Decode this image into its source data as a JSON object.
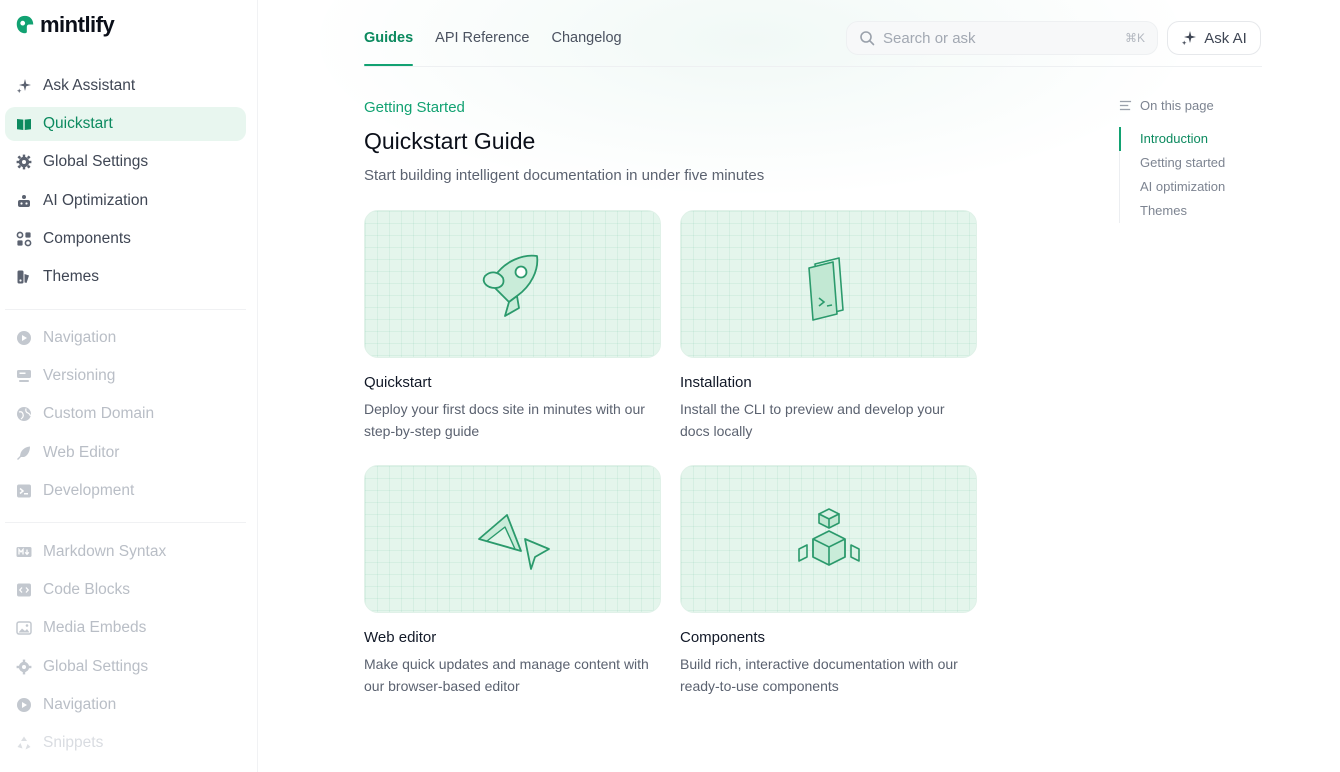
{
  "brand": {
    "name": "mintlify",
    "color": "#12a272"
  },
  "sidebar": {
    "primary": [
      {
        "label": "Ask Assistant",
        "icon": "sparkles-icon",
        "state": "normal"
      },
      {
        "label": "Quickstart",
        "icon": "book-icon",
        "state": "active"
      },
      {
        "label": "Global Settings",
        "icon": "gear-icon",
        "state": "normal"
      },
      {
        "label": "AI Optimization",
        "icon": "robot-icon",
        "state": "normal"
      },
      {
        "label": "Components",
        "icon": "components-icon",
        "state": "normal"
      },
      {
        "label": "Themes",
        "icon": "palette-icon",
        "state": "normal"
      }
    ],
    "secondary": [
      {
        "label": "Navigation",
        "icon": "compass-icon"
      },
      {
        "label": "Versioning",
        "icon": "versions-icon"
      },
      {
        "label": "Custom Domain",
        "icon": "globe-icon"
      },
      {
        "label": "Web Editor",
        "icon": "feather-icon"
      },
      {
        "label": "Development",
        "icon": "terminal-icon"
      }
    ],
    "tertiary": [
      {
        "label": "Markdown Syntax",
        "icon": "markdown-icon"
      },
      {
        "label": "Code Blocks",
        "icon": "code-icon"
      },
      {
        "label": "Media Embeds",
        "icon": "image-icon"
      },
      {
        "label": "Global Settings",
        "icon": "gear-icon"
      },
      {
        "label": "Navigation",
        "icon": "compass-icon"
      },
      {
        "label": "Snippets",
        "icon": "recycle-icon"
      }
    ]
  },
  "header": {
    "tabs": [
      {
        "label": "Guides",
        "active": true
      },
      {
        "label": "API Reference",
        "active": false
      },
      {
        "label": "Changelog",
        "active": false
      }
    ],
    "search": {
      "placeholder": "Search or ask",
      "shortcut": "⌘K"
    },
    "ask_ai": "Ask AI"
  },
  "main": {
    "eyebrow": "Getting Started",
    "title": "Quickstart Guide",
    "subtitle": "Start building intelligent documentation in under five minutes",
    "cards": [
      {
        "title": "Quickstart",
        "description": "Deploy your first docs site in minutes with our step-by-step guide",
        "icon": "rocket-icon"
      },
      {
        "title": "Installation",
        "description": "Install the CLI to preview and develop your docs locally",
        "icon": "terminal-window-icon"
      },
      {
        "title": "Web editor",
        "description": "Make quick updates and manage content with our browser-based editor",
        "icon": "cursor-icon"
      },
      {
        "title": "Components",
        "description": "Build rich, interactive documentation with our ready-to-use components",
        "icon": "blocks-icon"
      }
    ]
  },
  "toc": {
    "heading": "On this page",
    "items": [
      {
        "label": "Introduction",
        "active": true
      },
      {
        "label": "Getting started",
        "active": false
      },
      {
        "label": "AI optimization",
        "active": false
      },
      {
        "label": "Themes",
        "active": false
      }
    ]
  }
}
